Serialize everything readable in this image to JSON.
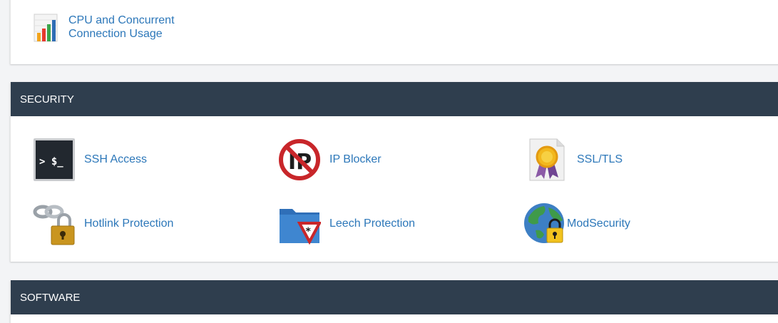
{
  "top_panel": {
    "cpu_item": {
      "label_line1": "CPU and Concurrent",
      "label_line2": "Connection Usage",
      "icon": "cpu-usage-bar-chart-icon"
    }
  },
  "security": {
    "header": "SECURITY",
    "items": [
      {
        "label": "SSH Access",
        "icon": "terminal-icon"
      },
      {
        "label": "IP Blocker",
        "icon": "ip-blocker-icon"
      },
      {
        "label": "SSL/TLS",
        "icon": "ssl-certificate-icon"
      },
      {
        "label": "Hotlink Protection",
        "icon": "chain-lock-icon"
      },
      {
        "label": "Leech Protection",
        "icon": "folder-yield-icon"
      },
      {
        "label": "ModSecurity",
        "icon": "globe-lock-icon"
      }
    ]
  },
  "software": {
    "header": "SOFTWARE"
  },
  "colors": {
    "header_bg": "#2f3e4e",
    "link": "#2c77b9",
    "page_bg": "#f3f4f6"
  }
}
